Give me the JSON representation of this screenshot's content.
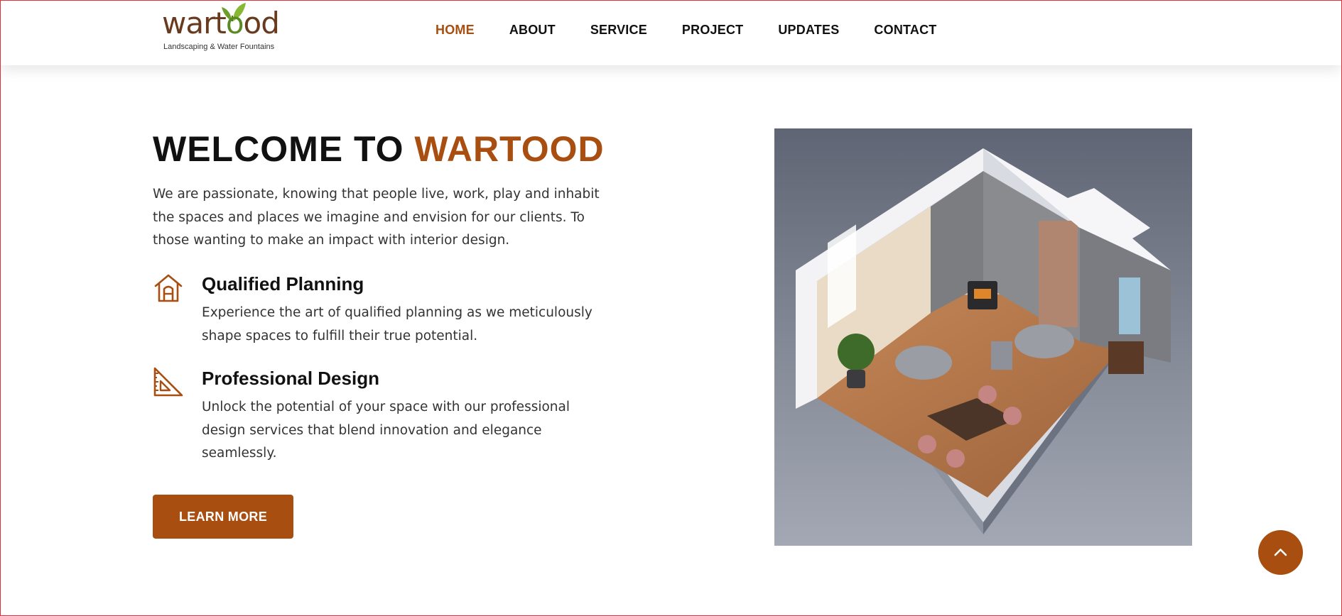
{
  "brand": {
    "name_part1": "wart",
    "name_part2": "o",
    "name_part3": "od",
    "tagline": "Landscaping & Water Fountains",
    "color": "#a84e10"
  },
  "nav": {
    "items": [
      {
        "label": "HOME",
        "active": true
      },
      {
        "label": "ABOUT",
        "active": false
      },
      {
        "label": "SERVICE",
        "active": false
      },
      {
        "label": "PROJECT",
        "active": false
      },
      {
        "label": "UPDATES",
        "active": false
      },
      {
        "label": "CONTACT",
        "active": false
      }
    ]
  },
  "hero": {
    "title_prefix": "WELCOME TO ",
    "title_accent": "WARTOOD",
    "intro": "We are passionate, knowing that people live, work, play and inhabit the spaces and places we imagine and envision for our clients. To those wanting to make an impact with interior design.",
    "features": [
      {
        "icon": "house-icon",
        "title": "Qualified Planning",
        "text": "Experience the art of qualified planning as we meticulously shape spaces to fulfill their true potential."
      },
      {
        "icon": "set-square-icon",
        "title": "Professional Design",
        "text": "Unlock the potential of your space with our professional design services that blend innovation and elegance seamlessly."
      }
    ],
    "button_label": "LEARN MORE",
    "image_icon": "isometric-room-illustration"
  },
  "scroll_top": {
    "icon": "chevron-up-icon"
  }
}
